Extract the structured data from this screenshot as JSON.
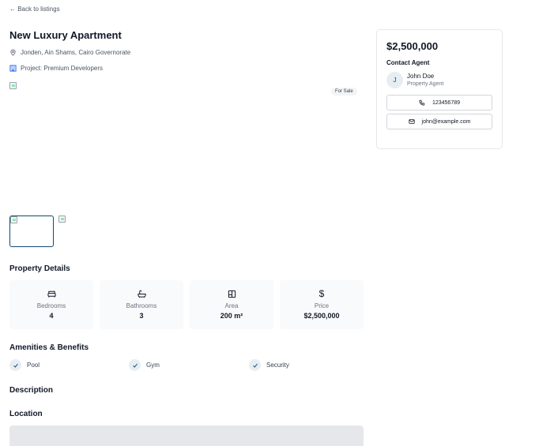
{
  "nav": {
    "back_label": "← Back to listings"
  },
  "listing": {
    "title": "New Luxury Apartment",
    "address": "Jonden, Ain Shams, Cairo Governorate",
    "project": "Project: Premium Developers",
    "status_badge": "For Sale"
  },
  "details": {
    "heading": "Property Details",
    "stats": [
      {
        "label": "Bedrooms",
        "value": "4",
        "icon": "bed-icon"
      },
      {
        "label": "Bathrooms",
        "value": "3",
        "icon": "bath-icon"
      },
      {
        "label": "Area",
        "value": "200 m²",
        "icon": "area-icon"
      },
      {
        "label": "Price",
        "value": "$2,500,000",
        "icon": "dollar-icon"
      }
    ]
  },
  "amenities": {
    "heading": "Amenities & Benefits",
    "items": [
      "Pool",
      "Gym",
      "Security"
    ]
  },
  "description": {
    "heading": "Description"
  },
  "location": {
    "heading": "Location"
  },
  "sidebar": {
    "price": "$2,500,000",
    "contact_heading": "Contact Agent",
    "agent_initial": "J",
    "agent_name": "John Doe",
    "agent_role": "Property Agent",
    "phone": "123456789",
    "email": "john@example.com"
  },
  "colors": {
    "accent": "#0e4a6e",
    "card_bg": "#f9fafb",
    "map_bg": "#e5e7eb"
  }
}
